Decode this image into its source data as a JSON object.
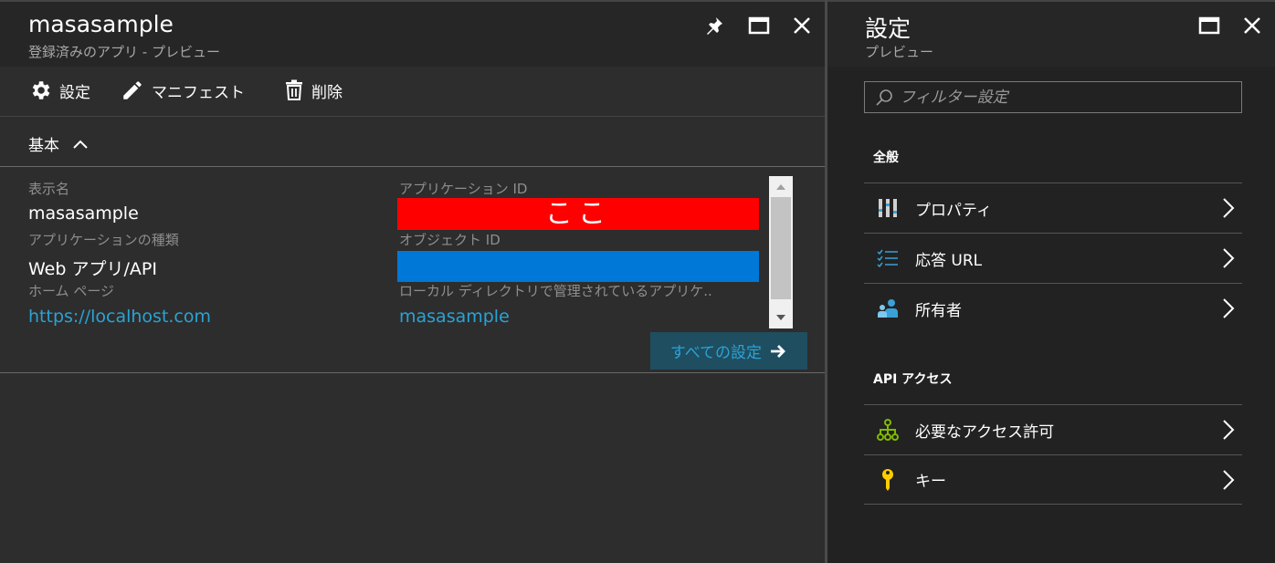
{
  "left_blade": {
    "title": "masasample",
    "subtitle": "登録済みのアプリ - プレビュー",
    "toolbar": {
      "settings_label": "設定",
      "manifest_label": "マニフェスト",
      "delete_label": "削除"
    },
    "section_label": "基本",
    "fields": {
      "display_name_label": "表示名",
      "display_name_value": "masasample",
      "app_type_label": "アプリケーションの種類",
      "app_type_value": "Web アプリ/API",
      "home_page_label": "ホーム ページ",
      "home_page_value": "https://localhost.com",
      "app_id_label": "アプリケーション ID",
      "app_id_highlight": "ここ",
      "object_id_label": "オブジェクト ID",
      "managed_app_label": "ローカル ディレクトリで管理されているアプリケ..",
      "managed_app_value": "masasample"
    },
    "all_settings_label": "すべての設定"
  },
  "right_blade": {
    "title": "設定",
    "subtitle": "プレビュー",
    "filter_placeholder": "フィルター設定",
    "groups": [
      {
        "label": "全般",
        "items": [
          {
            "label": "プロパティ",
            "icon": "properties-icon"
          },
          {
            "label": "応答 URL",
            "icon": "reply-url-icon"
          },
          {
            "label": "所有者",
            "icon": "owners-icon"
          }
        ]
      },
      {
        "label": "API アクセス",
        "items": [
          {
            "label": "必要なアクセス許可",
            "icon": "permissions-icon"
          },
          {
            "label": "キー",
            "icon": "key-icon"
          }
        ]
      }
    ]
  },
  "colors": {
    "highlight_red": "#ff0000",
    "highlight_blue": "#0078d7",
    "link": "#2aa3d6",
    "background": "#2d2d2d"
  }
}
